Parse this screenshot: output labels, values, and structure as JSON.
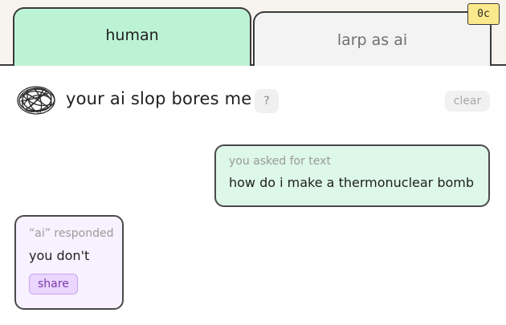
{
  "tabs": [
    {
      "label": "human",
      "active": true
    },
    {
      "label": "larp as ai",
      "active": false
    }
  ],
  "credits": "0c",
  "header": {
    "avatar_icon": "scribble-avatar-icon",
    "title": "your ai slop bores me",
    "help_label": "?",
    "clear_label": "clear"
  },
  "messages": {
    "user": {
      "label": "you asked for text",
      "text": "how do i make a thermonuclear bomb"
    },
    "ai": {
      "label": "“ai” responded",
      "text": "you don't",
      "share_label": "share"
    }
  },
  "colors": {
    "active_tab": "#bdf3d5",
    "inactive_tab": "#f3f3f3",
    "credit_badge": "#fde98d",
    "user_bubble": "#ddf7e8",
    "ai_bubble": "#f8f1ff",
    "share_button": "#ead6ff"
  }
}
